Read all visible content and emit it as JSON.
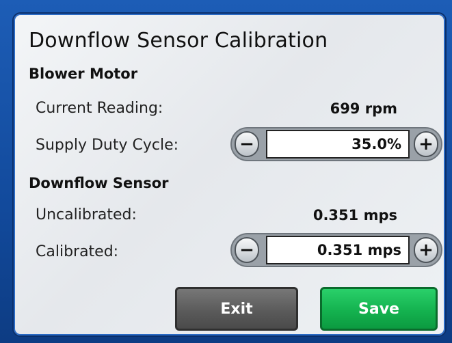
{
  "dialog": {
    "title": "Downflow Sensor Calibration"
  },
  "blower_motor": {
    "heading": "Blower Motor",
    "current_reading_label": "Current Reading:",
    "current_reading_value": "699 rpm",
    "supply_duty_cycle_label": "Supply Duty Cycle:",
    "supply_duty_cycle_value": "35.0%",
    "decrease_symbol": "−",
    "increase_symbol": "+"
  },
  "downflow_sensor": {
    "heading": "Downflow Sensor",
    "uncalibrated_label": "Uncalibrated:",
    "uncalibrated_value": "0.351 mps",
    "calibrated_label": "Calibrated:",
    "calibrated_value": "0.351 mps",
    "decrease_symbol": "−",
    "increase_symbol": "+"
  },
  "actions": {
    "exit_label": "Exit",
    "save_label": "Save"
  },
  "colors": {
    "frame": "#124a9c",
    "exit_button": "#5b5b5b",
    "save_button": "#14b24f"
  },
  "icons": {
    "decrease": "minus-icon",
    "increase": "plus-icon"
  }
}
